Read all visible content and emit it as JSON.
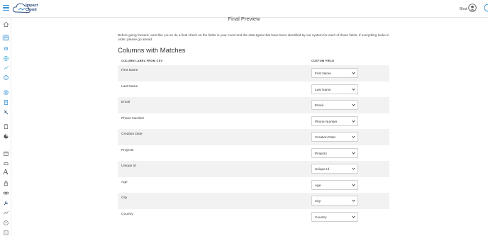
{
  "header": {
    "logo_text_line1": "Impact",
    "logo_text_line2": "Cloud",
    "user_name": "Bhat",
    "accent_color": "#2f8fd3",
    "icons": [
      "menu-icon",
      "logo-icon",
      "user-avatar-icon"
    ]
  },
  "sidebar": {
    "icons": [
      "home-icon",
      "grid-icon",
      "target-icon",
      "globe-icon",
      "chart-icon",
      "dollar-icon",
      "gear-icon",
      "document-icon",
      "tool-icon",
      "clipboard-icon",
      "pie-icon",
      "calendar-icon",
      "car-icon",
      "text-icon",
      "lock-icon",
      "link-icon",
      "wrench-icon",
      "analytics-icon",
      "gear-icon",
      "info-icon"
    ],
    "text_icon_glyph": "A"
  },
  "main": {
    "title": "Final Preview",
    "intro": "Before going forward, we'd like you to do a final check on the fields in your excel and the data types that have been identified by our system for each of those fields. If everything looks in order, please go ahead.",
    "section_title": "Columns with Matches",
    "col_csv": "COLUMN LABEL FROM CSV",
    "col_custom": "CUSTOM FIELD",
    "rows": [
      {
        "label": "First Name",
        "field": "First Name"
      },
      {
        "label": "Last Name",
        "field": "Last Name"
      },
      {
        "label": "Email",
        "field": "Email"
      },
      {
        "label": "Phone Number",
        "field": "Phone Number"
      },
      {
        "label": "Creation Date",
        "field": "Creation Date"
      },
      {
        "label": "Projects",
        "field": "Projects"
      },
      {
        "label": "Unique Id",
        "field": "Unique Id"
      },
      {
        "label": "Age",
        "field": "Age"
      },
      {
        "label": "City",
        "field": "City"
      },
      {
        "label": "Country",
        "field": "Country"
      }
    ]
  }
}
